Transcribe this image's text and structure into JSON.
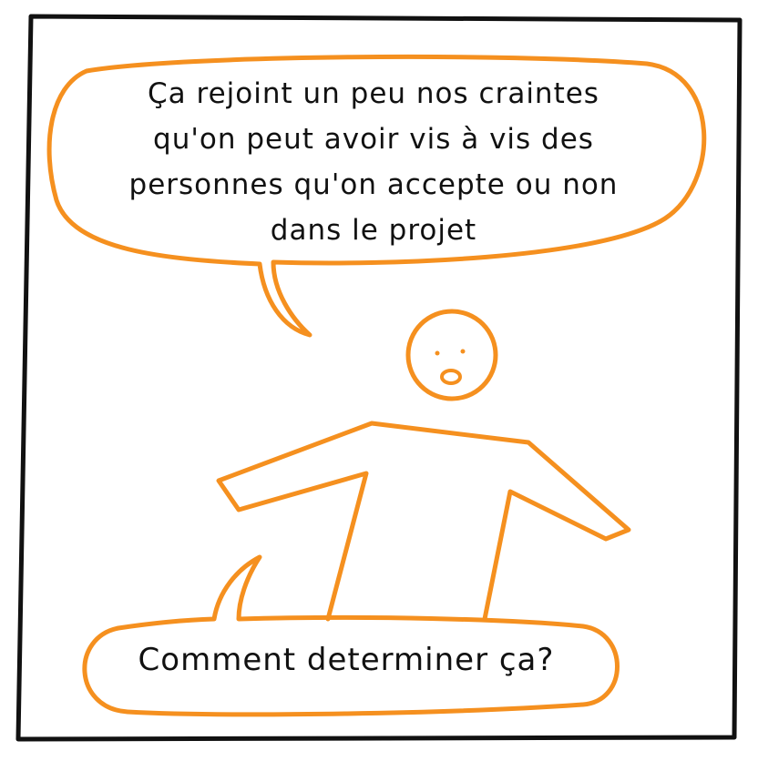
{
  "speech_top": {
    "lines": [
      "Ça rejoint un peu nos craintes",
      "qu'on peut avoir vis à vis des",
      "personnes qu'on accepte ou non",
      "dans le projet"
    ]
  },
  "speech_bottom": {
    "text": "Comment determiner ça?"
  },
  "colors": {
    "ink": "#111111",
    "accent": "#f5901f",
    "background": "#ffffff"
  }
}
